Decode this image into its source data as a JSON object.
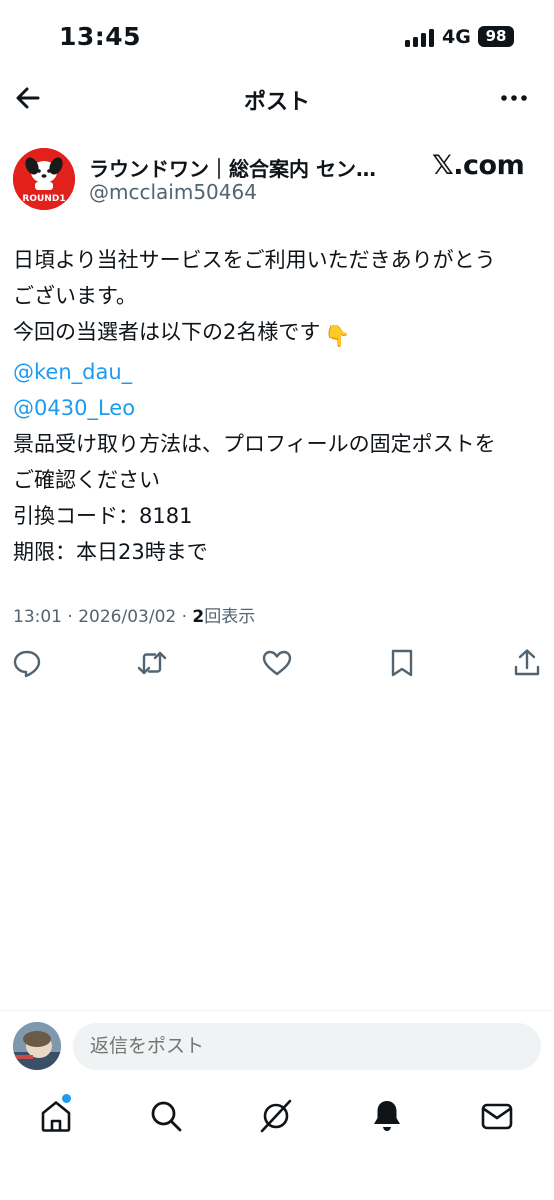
{
  "status_bar": {
    "time": "13:45",
    "network": "4G",
    "battery": "98"
  },
  "header": {
    "title": "ポスト"
  },
  "author": {
    "name": "ラウンドワン｜総合案内 セン…",
    "handle": "@mcclaim50464",
    "avatar_text": "ROUND1",
    "source_logo": "𝕏.com"
  },
  "post": {
    "lines": [
      "日頃より当社サービスをご利用いただきありがとう",
      "ございます。",
      "今回の当選者は以下の2名様です",
      "@ken_dau_",
      "@0430_Leo",
      "景品受け取り方法は、プロフィールの固定ポストを",
      "ご確認ください",
      "引換コード：8181",
      "期限：本日23時まで"
    ],
    "pointing_emoji": "👇"
  },
  "meta": {
    "time": "13:01",
    "date": "2026/03/02",
    "views_count": "2",
    "views_label": "回表示",
    "separator": "·"
  },
  "reply": {
    "placeholder": "返信をポスト"
  },
  "colors": {
    "accent": "#1d9bf0",
    "text": "#0f1419",
    "secondary": "#536471",
    "brand_red": "#e2211c"
  },
  "icons": {
    "actions": [
      "reply-icon",
      "repost-icon",
      "like-icon",
      "bookmark-icon",
      "share-icon"
    ],
    "nav": [
      "home-icon",
      "search-icon",
      "grok-icon",
      "notifications-icon",
      "messages-icon"
    ]
  }
}
